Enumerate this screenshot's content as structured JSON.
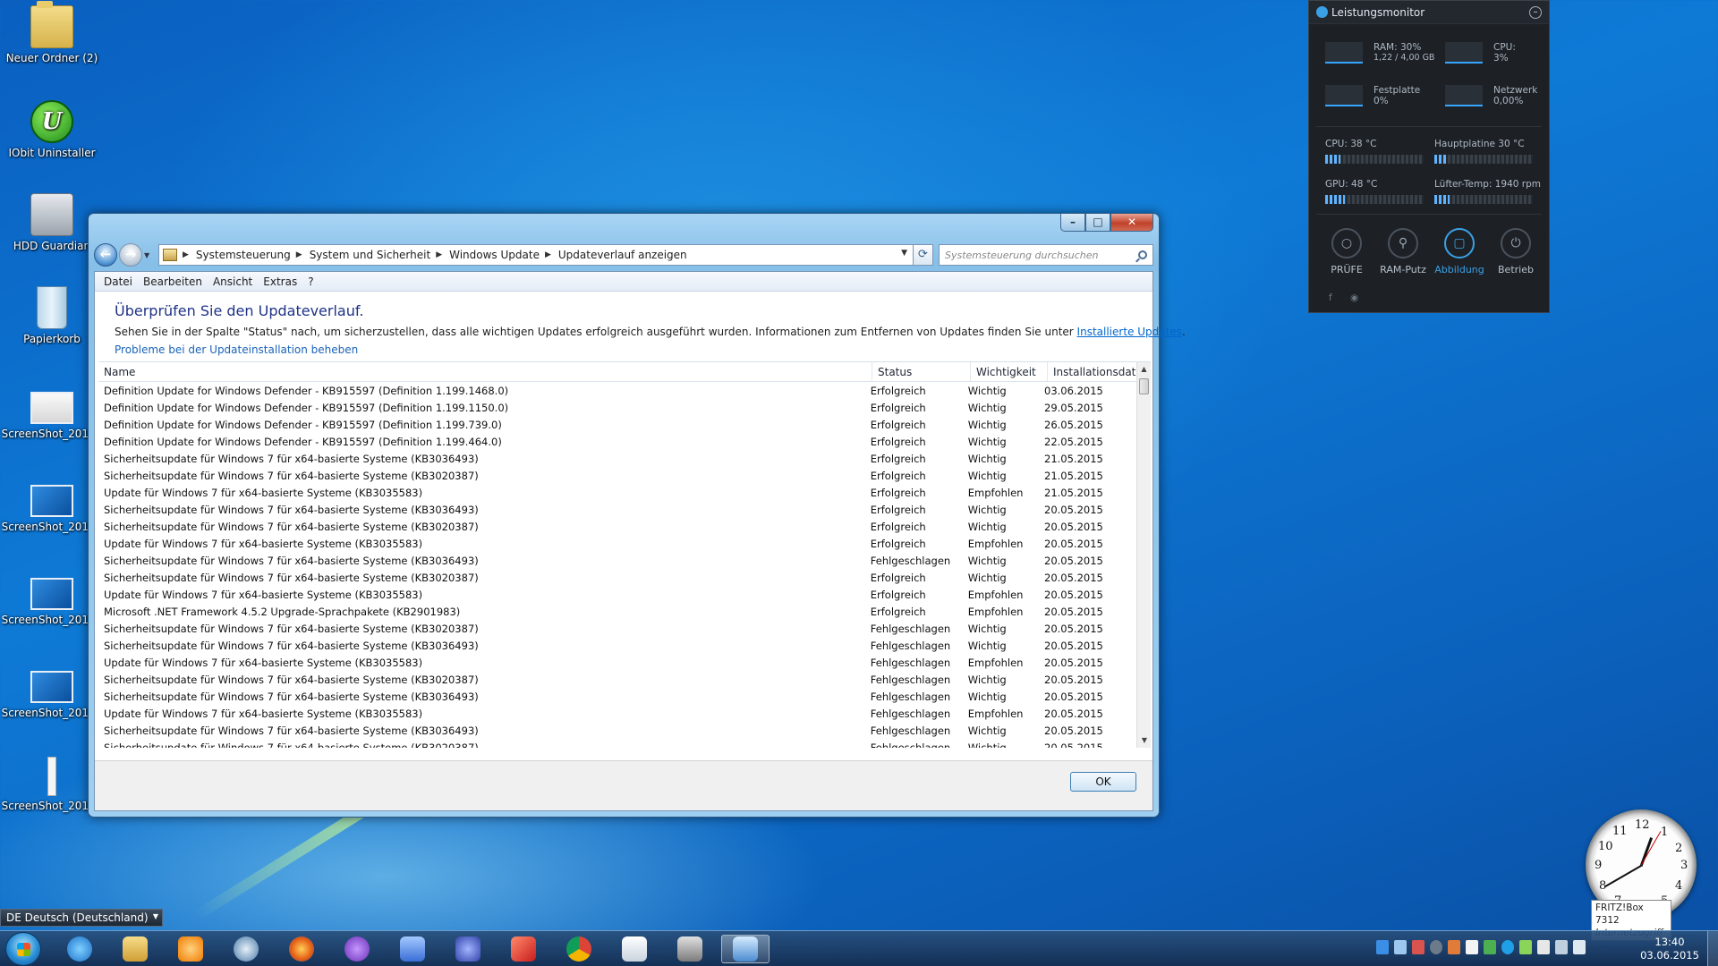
{
  "desktop": {
    "icons": [
      {
        "label": "Neuer Ordner (2)"
      },
      {
        "label": "IObit Uninstaller",
        "glyph": "U"
      },
      {
        "label": "HDD Guardian"
      },
      {
        "label": "Papierkorb"
      },
      {
        "label": "ScreenShot_20150"
      },
      {
        "label": "ScreenShot_20150"
      },
      {
        "label": "ScreenShot_20150"
      },
      {
        "label": "ScreenShot_20150"
      },
      {
        "label": "ScreenShot_20150"
      }
    ]
  },
  "window": {
    "controls": {
      "minimize": "–",
      "maximize": "□",
      "close": "✕"
    },
    "nav": {
      "back": "←",
      "forward": "→"
    },
    "breadcrumb": [
      "Systemsteuerung",
      "System und Sicherheit",
      "Windows Update",
      "Updateverlauf anzeigen"
    ],
    "search_placeholder": "Systemsteuerung durchsuchen",
    "menu": [
      "Datei",
      "Bearbeiten",
      "Ansicht",
      "Extras",
      "?"
    ],
    "heading": "Überprüfen Sie den Updateverlauf.",
    "description": "Sehen Sie in der Spalte \"Status\" nach, um sicherzustellen, dass alle wichtigen Updates erfolgreich ausgeführt wurden. Informationen zum Entfernen von Updates finden Sie unter ",
    "description_link": "Installierte Updates",
    "description_end": ".",
    "trouble_link": "Probleme bei der Updateinstallation beheben",
    "columns": {
      "name": "Name",
      "status": "Status",
      "importance": "Wichtigkeit",
      "date": "Installationsdatum"
    },
    "rows": [
      [
        "Definition Update for Windows Defender - KB915597 (Definition 1.199.1468.0)",
        "Erfolgreich",
        "Wichtig",
        "03.06.2015"
      ],
      [
        "Definition Update for Windows Defender - KB915597 (Definition 1.199.1150.0)",
        "Erfolgreich",
        "Wichtig",
        "29.05.2015"
      ],
      [
        "Definition Update for Windows Defender - KB915597 (Definition 1.199.739.0)",
        "Erfolgreich",
        "Wichtig",
        "26.05.2015"
      ],
      [
        "Definition Update for Windows Defender - KB915597 (Definition 1.199.464.0)",
        "Erfolgreich",
        "Wichtig",
        "22.05.2015"
      ],
      [
        "Sicherheitsupdate für Windows 7 für x64-basierte Systeme (KB3036493)",
        "Erfolgreich",
        "Wichtig",
        "21.05.2015"
      ],
      [
        "Sicherheitsupdate für Windows 7 für x64-basierte Systeme (KB3020387)",
        "Erfolgreich",
        "Wichtig",
        "21.05.2015"
      ],
      [
        "Update für Windows 7 für x64-basierte Systeme (KB3035583)",
        "Erfolgreich",
        "Empfohlen",
        "21.05.2015"
      ],
      [
        "Sicherheitsupdate für Windows 7 für x64-basierte Systeme (KB3036493)",
        "Erfolgreich",
        "Wichtig",
        "20.05.2015"
      ],
      [
        "Sicherheitsupdate für Windows 7 für x64-basierte Systeme (KB3020387)",
        "Erfolgreich",
        "Wichtig",
        "20.05.2015"
      ],
      [
        "Update für Windows 7 für x64-basierte Systeme (KB3035583)",
        "Erfolgreich",
        "Empfohlen",
        "20.05.2015"
      ],
      [
        "Sicherheitsupdate für Windows 7 für x64-basierte Systeme (KB3036493)",
        "Fehlgeschlagen",
        "Wichtig",
        "20.05.2015"
      ],
      [
        "Sicherheitsupdate für Windows 7 für x64-basierte Systeme (KB3020387)",
        "Erfolgreich",
        "Wichtig",
        "20.05.2015"
      ],
      [
        "Update für Windows 7 für x64-basierte Systeme (KB3035583)",
        "Erfolgreich",
        "Empfohlen",
        "20.05.2015"
      ],
      [
        "Microsoft .NET Framework 4.5.2 Upgrade-Sprachpakete (KB2901983)",
        "Erfolgreich",
        "Empfohlen",
        "20.05.2015"
      ],
      [
        "Sicherheitsupdate für Windows 7 für x64-basierte Systeme (KB3020387)",
        "Fehlgeschlagen",
        "Wichtig",
        "20.05.2015"
      ],
      [
        "Sicherheitsupdate für Windows 7 für x64-basierte Systeme (KB3036493)",
        "Fehlgeschlagen",
        "Wichtig",
        "20.05.2015"
      ],
      [
        "Update für Windows 7 für x64-basierte Systeme (KB3035583)",
        "Fehlgeschlagen",
        "Empfohlen",
        "20.05.2015"
      ],
      [
        "Sicherheitsupdate für Windows 7 für x64-basierte Systeme (KB3020387)",
        "Fehlgeschlagen",
        "Wichtig",
        "20.05.2015"
      ],
      [
        "Sicherheitsupdate für Windows 7 für x64-basierte Systeme (KB3036493)",
        "Fehlgeschlagen",
        "Wichtig",
        "20.05.2015"
      ],
      [
        "Update für Windows 7 für x64-basierte Systeme (KB3035583)",
        "Fehlgeschlagen",
        "Empfohlen",
        "20.05.2015"
      ],
      [
        "Sicherheitsupdate für Windows 7 für x64-basierte Systeme (KB3036493)",
        "Fehlgeschlagen",
        "Wichtig",
        "20.05.2015"
      ],
      [
        "Sicherheitsupdate für Windows 7 für x64-basierte Systeme (KB3020387)",
        "Fehlgeschlagen",
        "Wichtig",
        "20.05.2015"
      ]
    ],
    "ok_label": "OK"
  },
  "gadget": {
    "title": "Leistungsmonitor",
    "ram": {
      "label": "RAM: 30%",
      "detail": "1,22 / 4,00 GB"
    },
    "cpu": {
      "label": "CPU:",
      "value": "3%"
    },
    "disk": {
      "label": "Festplatte",
      "value": "0%"
    },
    "net": {
      "label": "Netzwerk",
      "value": "0,00%"
    },
    "cpu_temp": {
      "label": "CPU:  38 °C",
      "level": 0.15
    },
    "board_temp": {
      "label": "Hauptplatine  30 °C",
      "level": 0.12
    },
    "gpu_temp": {
      "label": "GPU:  48 °C",
      "level": 0.2
    },
    "fan": {
      "label": "Lüfter-Temp:  1940 rpm",
      "level": 0.15
    },
    "buttons": [
      {
        "label": "PRÜFE",
        "icon": "magnifier-icon"
      },
      {
        "label": "RAM-Putz",
        "icon": "broom-icon"
      },
      {
        "label": "Abbildung",
        "icon": "frame-icon"
      },
      {
        "label": "Betrieb",
        "icon": "power-icon"
      }
    ],
    "social": {
      "facebook": "f",
      "other": "◉"
    },
    "accent": "#3aa0e6"
  },
  "clock_gadget": {
    "numerals": [
      "12",
      "1",
      "2",
      "3",
      "4",
      "5",
      "6",
      "7",
      "8",
      "9",
      "10",
      "11"
    ],
    "time": "13:40"
  },
  "fritz": {
    "line1": "FRITZ!Box 7312",
    "line2": "Internetzugriff"
  },
  "language_bar": {
    "label": "DE Deutsch (Deutschland)"
  },
  "taskbar": {
    "pinned": [
      "start-button",
      "internet-explorer",
      "explorer",
      "media-player",
      "ccleaner",
      "firefox",
      "nvu",
      "chat",
      "network",
      "pdf",
      "chrome",
      "notepad",
      "printer",
      "control-panel"
    ],
    "time": "13:40",
    "date": "03.06.2015"
  }
}
